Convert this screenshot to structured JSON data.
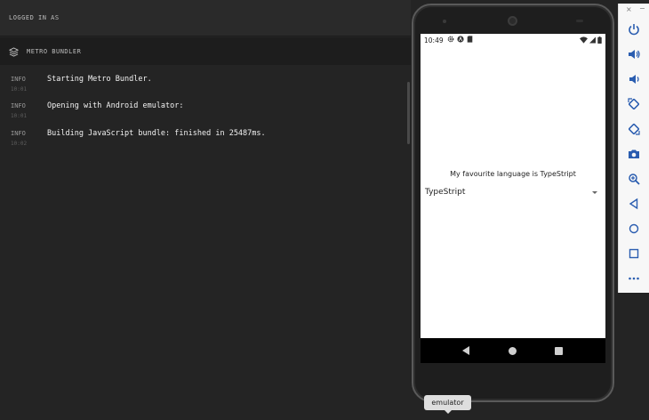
{
  "header": {
    "logged_in_label": "LOGGED IN AS"
  },
  "section": {
    "title": "METRO BUNDLER",
    "icon": "layers-icon"
  },
  "logs": [
    {
      "level": "INFO",
      "time": "10:01",
      "message": "Starting Metro Bundler."
    },
    {
      "level": "INFO",
      "time": "10:01",
      "message": "Opening with Android emulator:"
    },
    {
      "level": "INFO",
      "time": "10:02",
      "message": "Building JavaScript bundle: finished in 25487ms."
    }
  ],
  "phone": {
    "status_time": "10:49",
    "app_text": "My favourite language is TypeStript",
    "picker_value": "TypeStript"
  },
  "toolbar": {
    "close": "×",
    "minimize": "−",
    "buttons": [
      "power-icon",
      "volume-up-icon",
      "volume-down-icon",
      "rotate-left-icon",
      "rotate-right-icon",
      "camera-icon",
      "zoom-icon",
      "back-icon",
      "home-icon",
      "overview-icon",
      "more-icon"
    ]
  },
  "tooltip": {
    "label": "emulator"
  },
  "colors": {
    "terminal_bg": "#242424",
    "toolbar_icon": "#2a5db0"
  }
}
